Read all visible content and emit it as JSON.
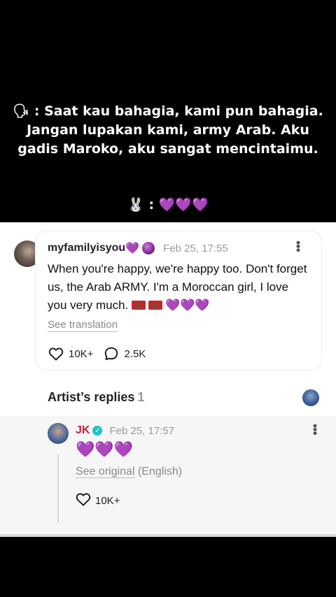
{
  "caption": {
    "speaker_icon": "speaking-head-icon",
    "text": ": Saat kau bahagia, kami pun bahagia. Jangan lupakan kami, army Arab. Aku gadis Maroko, aku sangat mencintaimu.",
    "reply_icon": "rabbit-face-icon",
    "reply_text": ":",
    "reply_hearts": "💜💜💜"
  },
  "post": {
    "username": "myfamilyisyou",
    "username_heart": "💜",
    "date": "Feb 25, 17:55",
    "body": "When you're happy, we're happy too. Don't forget us, the Arab ARMY. I'm a Moroccan girl, I love you very much.",
    "body_hearts": "💜💜💜",
    "see_translation": "See translation",
    "likes": "10K+",
    "comments": "2.5K"
  },
  "artist_replies": {
    "title": "Artist’s replies",
    "count": "1"
  },
  "reply": {
    "name": "JK",
    "date": "Feb 25, 17:57",
    "body": "💜💜💜",
    "see_original": "See original",
    "language": "(English)",
    "likes": "10K+"
  },
  "colors": {
    "accent_heart": "#9b30ff",
    "artist_name": "#c9203a",
    "verified": "#1fc3c9"
  }
}
